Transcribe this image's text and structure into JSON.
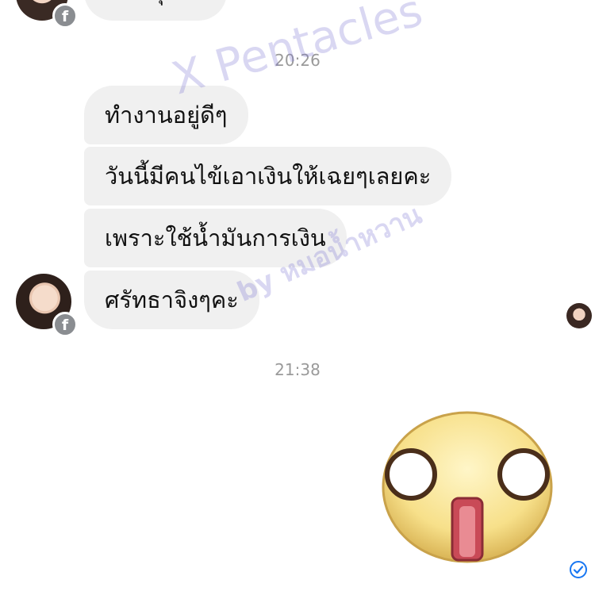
{
  "conversation": {
    "top_bubble_partial": "ขอบคุณคะ",
    "timestamp_1": "20:26",
    "messages": [
      "ทำงานอยู่ดีๆ",
      "วันนี้มีคนไข้เอาเงินให้เฉยๆเลยคะ",
      "เพราะใช้น้ำมันการเงิน",
      "ศรัทธาจิงๆคะ"
    ],
    "timestamp_2": "21:38"
  },
  "watermark": {
    "line1": "X Pentacles",
    "line2": "by หมอน้ำหวาน"
  },
  "icons": {
    "badge": "facebook-icon",
    "status": "check-circle-icon",
    "sticker": "shocked-face-sticker"
  },
  "colors": {
    "bubble_bg": "#f0f0f0",
    "timestamp": "#9a9a9a",
    "seen_check": "#1877f2",
    "watermark": "#786ed2"
  }
}
